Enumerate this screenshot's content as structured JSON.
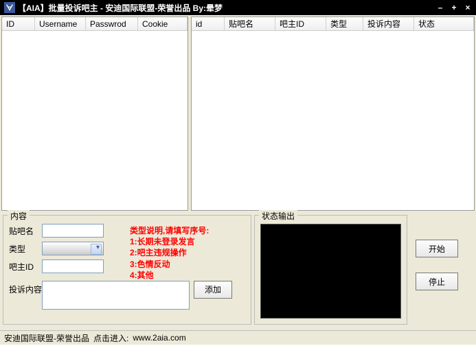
{
  "titlebar": {
    "text": "【AIA】批量投诉吧主 - 安迪国际联盟-荣誉出品    By:晕梦"
  },
  "left_table": {
    "cols": [
      "ID",
      "Username",
      "Passwrod",
      "Cookie"
    ]
  },
  "right_table": {
    "cols": [
      "id",
      "贴吧名",
      "吧主ID",
      "类型",
      "投诉内容",
      "状态"
    ]
  },
  "content_box": {
    "title": "内容",
    "labels": {
      "tieba_name": "贴吧名",
      "type": "类型",
      "bazhu_id": "吧主ID",
      "complaint": "投诉内容"
    },
    "add_btn": "添加",
    "type_desc": {
      "l0": "类型说明,请填写序号:",
      "l1": "1:长期未登录发言",
      "l2": "2:吧主违规操作",
      "l3": "3:色情反动",
      "l4": "4:其他"
    }
  },
  "status_box": {
    "title": "状态输出"
  },
  "buttons": {
    "start": "开始",
    "stop": "停止"
  },
  "statusbar": {
    "left": "安迪国际联盟-荣誉出品",
    "link_pre": "点击进入:",
    "link": "www.2aia.com"
  }
}
